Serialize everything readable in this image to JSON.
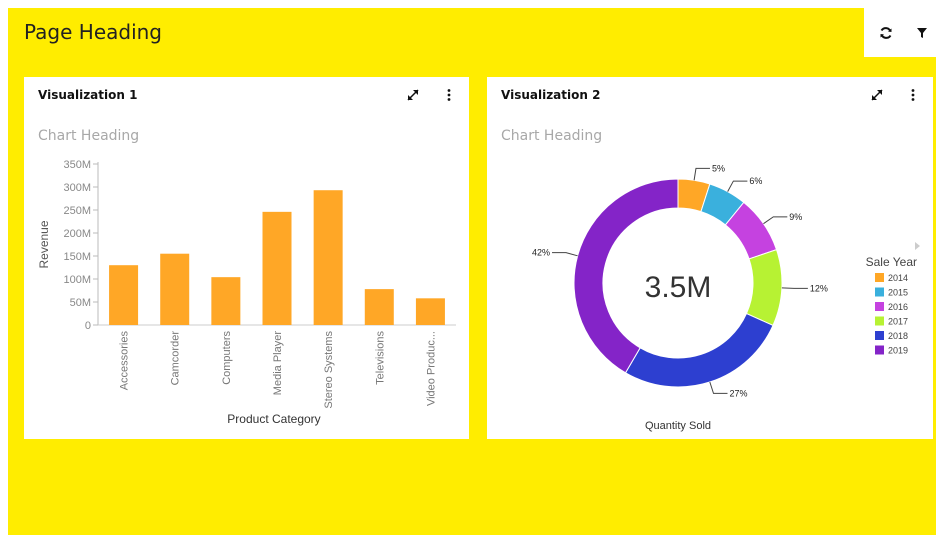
{
  "page": {
    "title": "Page Heading"
  },
  "toolbar": {
    "refresh_icon": "refresh-icon",
    "filter_icon": "filter-icon"
  },
  "viz1": {
    "title": "Visualization 1",
    "chart_heading": "Chart Heading",
    "expand_icon": "expand-icon",
    "menu_icon": "more-vertical-icon",
    "chart_data": {
      "type": "bar",
      "categories": [
        "Accessories",
        "Camcorder",
        "Computers",
        "Media Player",
        "Stereo Systems",
        "Televisions",
        "Video Produc..."
      ],
      "values": [
        130000000,
        155000000,
        104000000,
        246000000,
        293000000,
        78000000,
        58000000
      ],
      "ylabel": "Revenue",
      "xlabel": "Product Category",
      "ylim": [
        0,
        350000000
      ],
      "yticks": [
        0,
        50000000,
        100000000,
        150000000,
        200000000,
        250000000,
        300000000,
        350000000
      ],
      "ytick_labels": [
        "0",
        "50M",
        "100M",
        "150M",
        "200M",
        "250M",
        "300M",
        "350M"
      ],
      "color": "#ffa726"
    }
  },
  "viz2": {
    "title": "Visualization 2",
    "chart_heading": "Chart Heading",
    "expand_icon": "expand-icon",
    "menu_icon": "more-vertical-icon",
    "chart_data": {
      "type": "pie",
      "donut": true,
      "center_label": "3.5M",
      "xlabel": "Quantity Sold",
      "legend_title": "Sale Year",
      "legend_position": "right",
      "categories": [
        "2014",
        "2015",
        "2016",
        "2017",
        "2018",
        "2019"
      ],
      "values": [
        5,
        6,
        9,
        12,
        27,
        42
      ],
      "labels": [
        "5%",
        "6%",
        "9%",
        "12%",
        "27%",
        "42%"
      ],
      "colors": [
        "#ffa726",
        "#3ab0dd",
        "#c542e0",
        "#b7f233",
        "#2d3fd0",
        "#8424c8"
      ]
    }
  }
}
